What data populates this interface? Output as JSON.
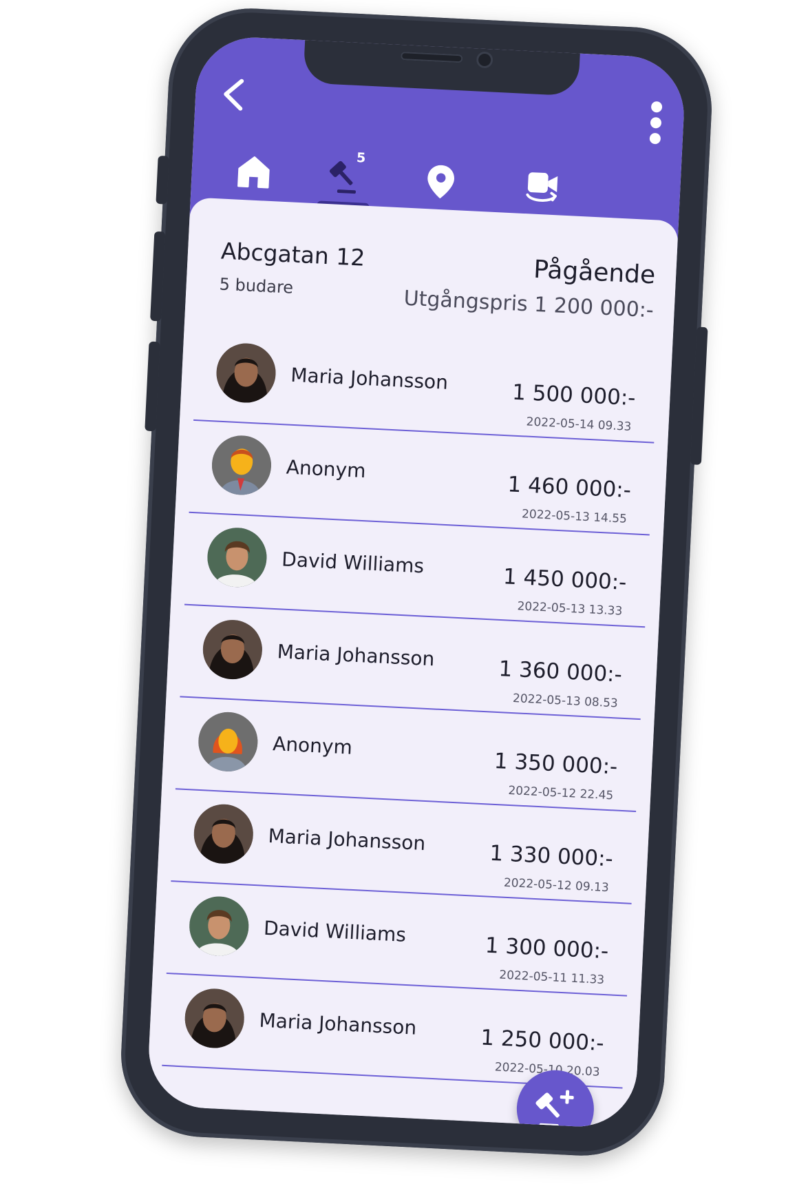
{
  "colors": {
    "accent": "#6757cc",
    "background": "#f2effa",
    "divider": "#6c5fd6",
    "phone_frame": "#2b2f3a"
  },
  "header": {
    "back_icon": "chevron-left-icon",
    "menu_icon": "more-vertical-icon",
    "tabs": [
      {
        "name": "home",
        "icon": "home-icon"
      },
      {
        "name": "bids",
        "icon": "gavel-icon",
        "badge": "5",
        "active": true
      },
      {
        "name": "location",
        "icon": "location-pin-icon"
      },
      {
        "name": "video",
        "icon": "video-rotate-icon"
      }
    ]
  },
  "property": {
    "title": "Abcgatan 12",
    "bidders": "5 budare",
    "status": "Pågående",
    "start_price": "Utgångspris 1 200 000:-"
  },
  "bids": [
    {
      "name": "Maria Johansson",
      "amount": "1 500 000:-",
      "time": "2022-05-14 09.33",
      "avatar": "woman-dark-hair"
    },
    {
      "name": "Anonym",
      "amount": "1 460 000:-",
      "time": "2022-05-13 14.55",
      "avatar": "anonymous-man"
    },
    {
      "name": "David Williams",
      "amount": "1 450 000:-",
      "time": "2022-05-13 13.33",
      "avatar": "man-brown-hair"
    },
    {
      "name": "Maria Johansson",
      "amount": "1 360 000:-",
      "time": "2022-05-13 08.53",
      "avatar": "woman-dark-hair"
    },
    {
      "name": "Anonym",
      "amount": "1 350 000:-",
      "time": "2022-05-12 22.45",
      "avatar": "anonymous-woman"
    },
    {
      "name": "Maria Johansson",
      "amount": "1 330 000:-",
      "time": "2022-05-12 09.13",
      "avatar": "woman-dark-hair"
    },
    {
      "name": "David Williams",
      "amount": "1 300 000:-",
      "time": "2022-05-11 11.33",
      "avatar": "man-brown-hair"
    },
    {
      "name": "Maria Johansson",
      "amount": "1 250 000:-",
      "time": "2022-05-10 20.03",
      "avatar": "woman-dark-hair"
    }
  ],
  "fab": {
    "icon": "gavel-plus-icon"
  }
}
